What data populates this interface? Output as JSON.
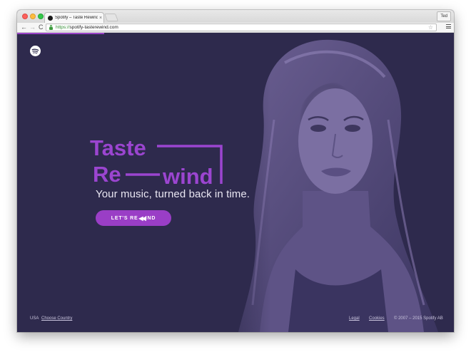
{
  "browser": {
    "tab_title": "Spotify – Taste Rewind",
    "tab_close": "×",
    "profile_name": "Ted",
    "url_scheme": "https://",
    "url_host": "spotify-tasterewind.com",
    "nav_back": "←",
    "nav_forward": "→",
    "nav_reload": "C",
    "star": "☆",
    "load_progress": 0.2
  },
  "hero": {
    "logo_word1": "Taste",
    "logo_word2a": "Re",
    "logo_word2b": "wind",
    "tagline": "Your music, turned back in time.",
    "cta_part1": "LET'S RE",
    "cta_icon": "◀◀",
    "cta_part2": "IND"
  },
  "footer": {
    "country": "USA",
    "choose_country": "Choose Country",
    "legal": "Legal",
    "cookies": "Cookies",
    "copyright": "© 2007 – 2015 Spotify AB"
  },
  "colors": {
    "page_bg": "#2e2a4d",
    "accent_purple": "#9a3ec6",
    "logo_purple": "#9b45d0",
    "text_light": "#e9e6f2"
  },
  "icons": {
    "brand": "spotify-icon",
    "security": "lock-icon",
    "bookmark": "star-icon",
    "menu": "menu-icon"
  }
}
